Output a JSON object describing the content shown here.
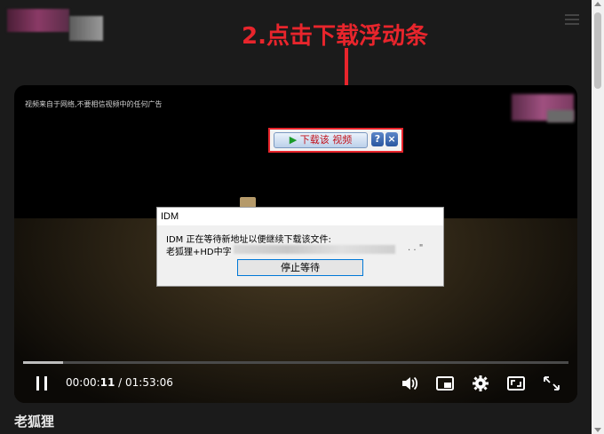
{
  "header": {
    "menu_icon": "hamburger-icon"
  },
  "annotation": {
    "text": "2.点击下载浮动条",
    "color": "#e8252c"
  },
  "player": {
    "watermark_text": "视频来自于网络,不要相信视频中的任何广告",
    "idm_bar": {
      "button_label": "下载该 视频",
      "help_label": "?",
      "close_label": "×"
    },
    "dialog": {
      "title": "IDM",
      "message_line1": "IDM 正在等待新地址以便继续下载该文件:",
      "message_line2_prefix": "老狐狸+HD中字",
      "stop_button": "停止等待"
    },
    "controls": {
      "progress_fraction": 0.074,
      "current_time": "00:00:11",
      "separator": " / ",
      "duration": "01:53:06",
      "icons": [
        "pause-icon",
        "volume-icon",
        "picture-in-picture-icon",
        "settings-gear-icon",
        "theater-mode-icon",
        "fullscreen-icon"
      ]
    }
  },
  "page": {
    "title": "老狐狸"
  }
}
